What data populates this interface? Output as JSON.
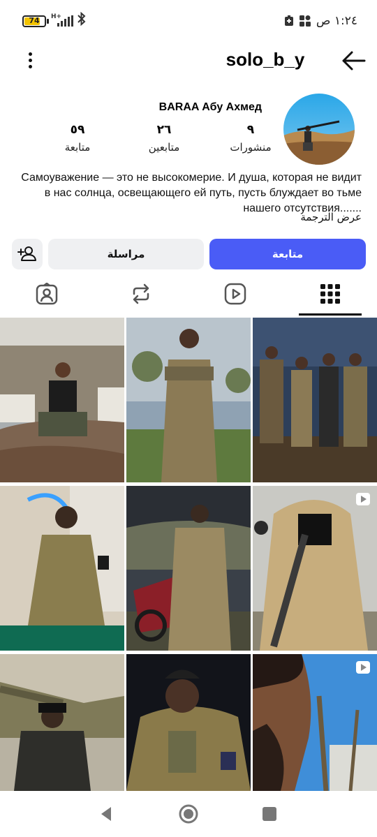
{
  "status_bar": {
    "battery": "74",
    "battery_level": 0.74,
    "network": "H+",
    "time": "١:٢٤ ص",
    "icons": [
      "battery-icon",
      "signal-icon",
      "bluetooth-icon",
      "grid-apps-icon",
      "sim-icon"
    ]
  },
  "header": {
    "username": "solo_b_y",
    "back_icon": "arrow-left-icon",
    "menu_icon": "more-vertical-icon"
  },
  "profile": {
    "display_name": "BARAA Абу Ахмед",
    "stats": [
      {
        "value": "٩",
        "label": "منشورات"
      },
      {
        "value": "٢٦",
        "label": "متابعين"
      },
      {
        "value": "٥٩",
        "label": "متابعة"
      }
    ],
    "bio": "Самоуважение — это не высокомерие. И душа, которая не видит в нас солнца, освещающего ей путь, пусть блуждает во тьме нашего отсутствия.......",
    "translate_label": "عرض الترجمة"
  },
  "actions": {
    "follow_label": "متابعة",
    "message_label": "مراسلة",
    "add_icon": "add-person-icon",
    "follow_color": "#4a5cf6"
  },
  "tabs": [
    {
      "name": "posts-grid",
      "icon": "grid-icon",
      "active": true
    },
    {
      "name": "reels",
      "icon": "reels-icon",
      "active": false
    },
    {
      "name": "reposts",
      "icon": "repost-icon",
      "active": false
    },
    {
      "name": "tagged",
      "icon": "tagged-user-icon",
      "active": false
    }
  ],
  "posts": [
    {
      "video": false
    },
    {
      "video": false
    },
    {
      "video": false
    },
    {
      "video": false
    },
    {
      "video": false
    },
    {
      "video": true
    },
    {
      "video": false
    },
    {
      "video": false
    },
    {
      "video": true
    }
  ],
  "navbar": {
    "icons": [
      "back-triangle-icon",
      "home-circle-icon",
      "recents-square-icon"
    ]
  }
}
